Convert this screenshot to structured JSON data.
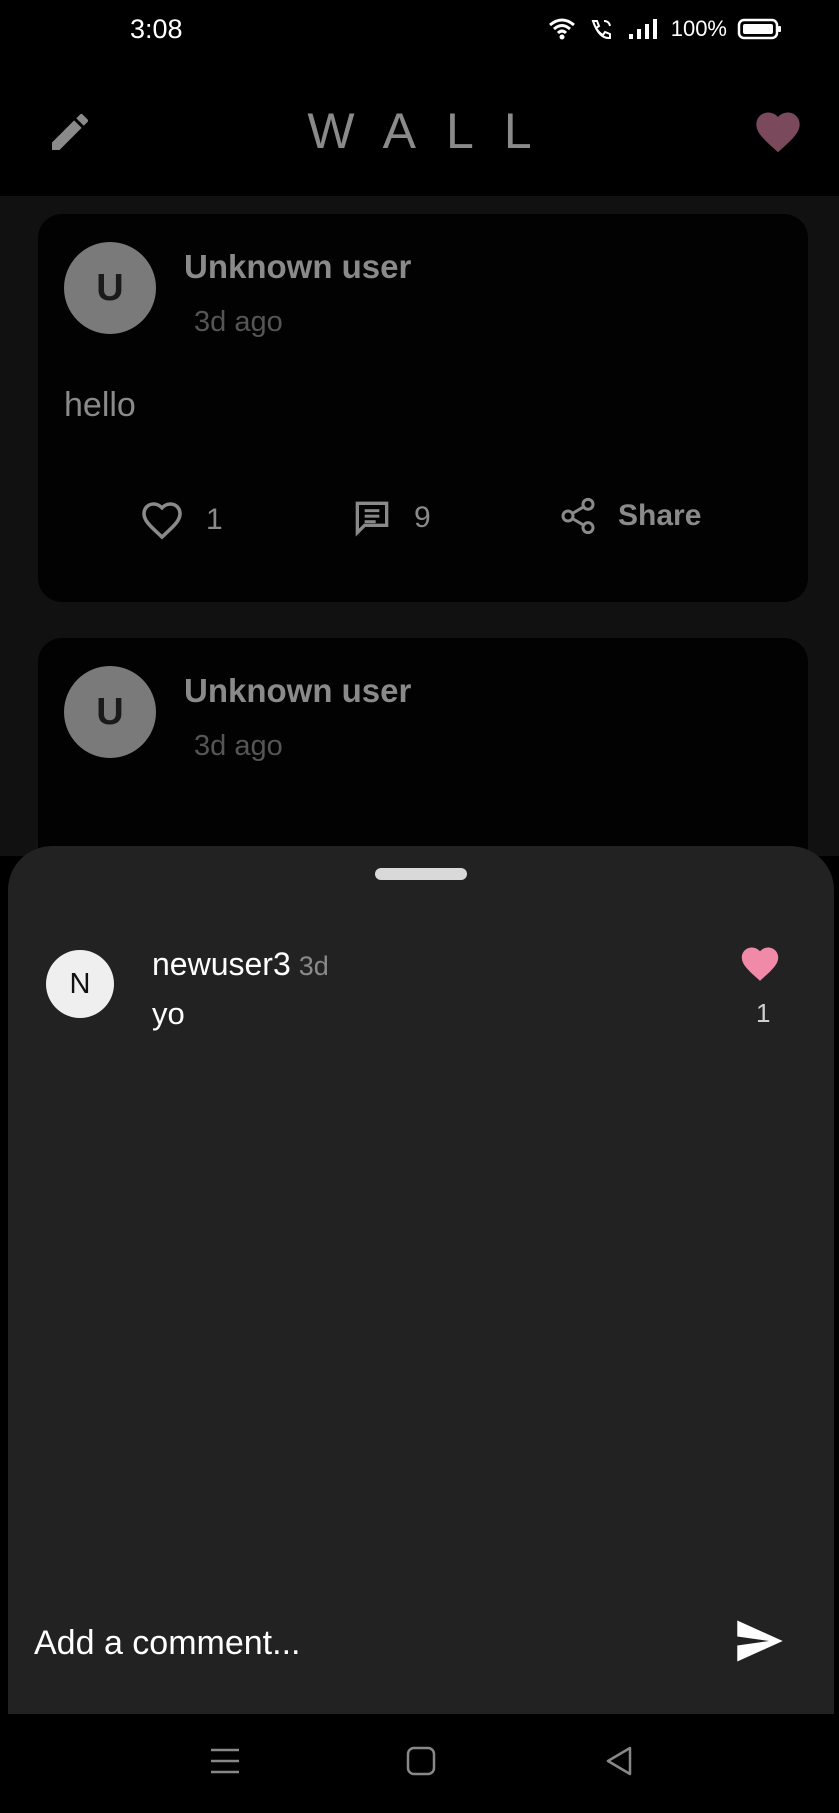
{
  "status": {
    "time": "3:08",
    "battery": "100%"
  },
  "header": {
    "title": "WALL"
  },
  "posts": [
    {
      "avatar_letter": "U",
      "author": "Unknown user",
      "time": "3d ago",
      "body": "hello",
      "likes": "1",
      "comments": "9",
      "share_label": "Share"
    },
    {
      "avatar_letter": "U",
      "author": "Unknown user",
      "time": "3d ago"
    }
  ],
  "comments": [
    {
      "avatar_letter": "N",
      "user": "newuser3",
      "time": "3d",
      "text": "yo",
      "likes": "1"
    }
  ],
  "comment_input": {
    "placeholder": "Add a comment..."
  },
  "colors": {
    "accent_like": "#f08aa8",
    "header_heart": "#7a4a5c",
    "sheet_bg": "#222222"
  }
}
